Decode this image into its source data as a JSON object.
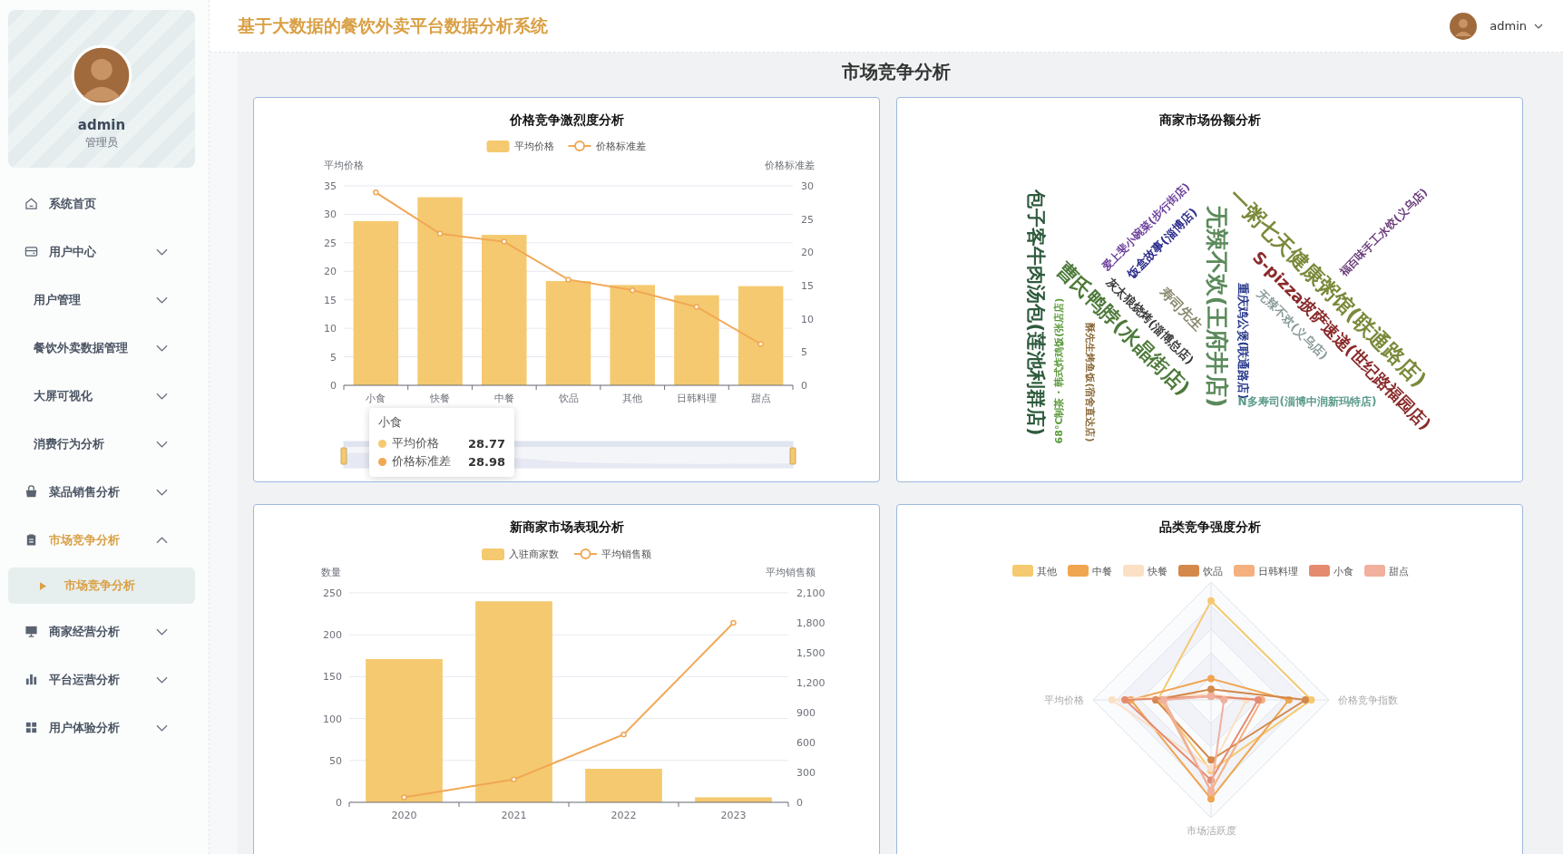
{
  "header": {
    "title": "基于大数据的餐饮外卖平台数据分析系统",
    "user": "admin"
  },
  "sidebar": {
    "profile": {
      "name": "admin",
      "role": "管理员"
    },
    "menu": [
      {
        "label": "系统首页",
        "kind": "link"
      },
      {
        "label": "用户中心",
        "kind": "group",
        "expanded": false
      },
      {
        "label": "用户管理",
        "kind": "subgroup",
        "expanded": false
      },
      {
        "label": "餐饮外卖数据管理",
        "kind": "subgroup",
        "expanded": false
      },
      {
        "label": "大屏可视化",
        "kind": "subgroup",
        "expanded": false
      },
      {
        "label": "消费行为分析",
        "kind": "subgroup",
        "expanded": false
      },
      {
        "label": "菜品销售分析",
        "kind": "group",
        "expanded": false
      },
      {
        "label": "市场竞争分析",
        "kind": "group",
        "expanded": true,
        "children": [
          {
            "label": "市场竞争分析",
            "selected": true
          }
        ]
      },
      {
        "label": "商家经营分析",
        "kind": "group",
        "expanded": false
      },
      {
        "label": "平台运营分析",
        "kind": "group",
        "expanded": false
      },
      {
        "label": "用户体验分析",
        "kind": "group",
        "expanded": false
      }
    ]
  },
  "page_title": "市场竞争分析",
  "price_chart": {
    "title": "价格竞争激烈度分析",
    "chart_data": {
      "type": "bar",
      "categories": [
        "小食",
        "快餐",
        "中餐",
        "饮品",
        "其他",
        "日韩料理",
        "甜点"
      ],
      "ylabel": "平均价格",
      "y2label": "价格标准差",
      "ylim": [
        0,
        35
      ],
      "y2lim": [
        0,
        30
      ],
      "yticks": [
        0,
        5,
        10,
        15,
        20,
        25,
        30,
        35
      ],
      "y2ticks": [
        0,
        5,
        10,
        15,
        20,
        25,
        30
      ],
      "series": [
        {
          "name": "平均价格",
          "type": "bar",
          "color": "#f5c96f",
          "values": [
            28.8,
            33.0,
            26.4,
            18.3,
            17.6,
            15.8,
            17.4
          ]
        },
        {
          "name": "价格标准差",
          "type": "line",
          "marker": "circle",
          "axis": "y2",
          "color": "#f0a855",
          "values": [
            29.0,
            22.8,
            21.6,
            15.9,
            14.3,
            11.8,
            6.2
          ]
        }
      ],
      "grid": true,
      "legend": "top"
    },
    "tooltip": {
      "title": "小食",
      "rows": [
        {
          "name": "平均价格",
          "value": "28.77",
          "color": "#f5c96f"
        },
        {
          "name": "价格标准差",
          "value": "28.98",
          "color": "#f0a855"
        }
      ]
    }
  },
  "share_cloud": {
    "title": "商家市场份额分析",
    "words": [
      {
        "text": "包子客牛肉汤包(莲池利群店)",
        "color": "#2e5a3c"
      },
      {
        "text": "68°C制茶 · 韩式炸鸡饭(张店店)",
        "color": "#5c9a3c"
      },
      {
        "text": "酥先生烤鱼饭(宿舍直达店)",
        "color": "#8b6a3a"
      },
      {
        "text": "曹氏鸭脖(水晶街店)",
        "color": "#4d7a3a"
      },
      {
        "text": "灰太狼烧烤(淄博总店)",
        "color": "#3a3a3a"
      },
      {
        "text": "爱上斐小碗菜(步行街店)",
        "color": "#6a3d9a"
      },
      {
        "text": "饭盒故事(淄博店)",
        "color": "#2b2b8a"
      },
      {
        "text": "寿司先生",
        "color": "#8a8a70"
      },
      {
        "text": "无辣不欢(王府井店)",
        "color": "#5b8a5b"
      },
      {
        "text": "重庆鸡公煲(联通路店)",
        "color": "#2a3a8c"
      },
      {
        "text": "N多寿司(淄博中润新玛特店)",
        "color": "#5a9a8a"
      },
      {
        "text": "一粥七天健康粥馆(联通路店)",
        "color": "#7a8a3a"
      },
      {
        "text": "S-pizza披萨速递(世纪路福园店)",
        "color": "#8a2a2a"
      },
      {
        "text": "无辣不欢(义乌店)",
        "color": "#8a9a9a"
      },
      {
        "text": "福百味手工水饺(义乌店)",
        "color": "#6a3a7a"
      }
    ]
  },
  "new_merchant_chart": {
    "title": "新商家市场表现分析",
    "chart_data": {
      "type": "bar",
      "categories": [
        "2020",
        "2021",
        "2022",
        "2023"
      ],
      "ylabel": "数量",
      "y2label": "平均销售额",
      "ylim": [
        0,
        250
      ],
      "y2lim": [
        0,
        2100
      ],
      "yticks": [
        0,
        50,
        100,
        150,
        200,
        250
      ],
      "y2ticks": [
        0,
        {
          "value": 300,
          "label": "300"
        },
        {
          "value": 600,
          "label": "600"
        },
        {
          "value": 900,
          "label": "900"
        },
        {
          "value": 1200,
          "label": "1,200"
        },
        {
          "value": 1500,
          "label": "1,500"
        },
        {
          "value": 1800,
          "label": "1,800"
        },
        {
          "value": 2100,
          "label": "2,100"
        }
      ],
      "series": [
        {
          "name": "入驻商家数",
          "type": "bar",
          "color": "#f5c96f",
          "values": [
            171,
            240,
            40,
            6
          ]
        },
        {
          "name": "平均销售额",
          "type": "line",
          "marker": "circle",
          "axis": "y2",
          "color": "#f0a855",
          "values": [
            50,
            230,
            680,
            1800
          ]
        }
      ],
      "grid": true,
      "legend": "top"
    }
  },
  "category_radar": {
    "title": "品类竞争强度分析",
    "legend": [
      {
        "name": "其他",
        "color": "#f5c96f"
      },
      {
        "name": "中餐",
        "color": "#f0a550"
      },
      {
        "name": "快餐",
        "color": "#fbe0c4"
      },
      {
        "name": "饮品",
        "color": "#d4884a"
      },
      {
        "name": "日韩料理",
        "color": "#f5b07f"
      },
      {
        "name": "小食",
        "color": "#e58a6e"
      },
      {
        "name": "甜点",
        "color": "#f0b09d"
      }
    ],
    "axes": [
      "平均价格",
      "价格竞争指数",
      "市场活跃度"
    ]
  }
}
